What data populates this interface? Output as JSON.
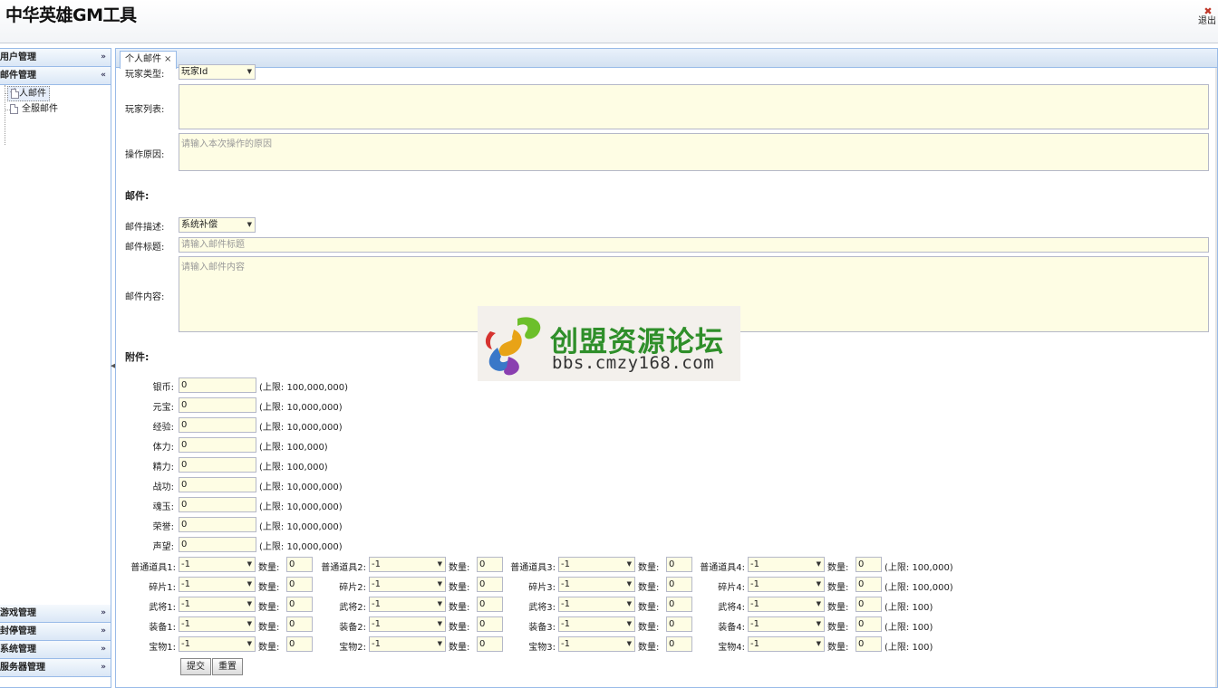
{
  "app": {
    "title": "中华英雄GM工具",
    "logout_label": "退出"
  },
  "sidebar": {
    "sections": [
      {
        "label": "用户管理",
        "expanded": false
      },
      {
        "label": "邮件管理",
        "expanded": true
      },
      {
        "label": "游戏管理",
        "expanded": false
      },
      {
        "label": "封停管理",
        "expanded": false
      },
      {
        "label": "系统管理",
        "expanded": false
      },
      {
        "label": "服务器管理",
        "expanded": false
      }
    ],
    "mail_items": [
      {
        "label": "个人邮件",
        "selected": true
      },
      {
        "label": "全服邮件",
        "selected": false
      }
    ]
  },
  "tab": {
    "label": "个人邮件",
    "close": "×"
  },
  "form": {
    "player_type_label": "玩家类型:",
    "player_type_value": "玩家Id",
    "player_list_label": "玩家列表:",
    "reason_label": "操作原因:",
    "reason_placeholder": "请输入本次操作的原因",
    "mail_section": "邮件:",
    "mail_desc_label": "邮件描述:",
    "mail_desc_value": "系统补偿",
    "mail_title_label": "邮件标题:",
    "mail_title_placeholder": "请输入邮件标题",
    "mail_content_label": "邮件内容:",
    "mail_content_placeholder": "请输入邮件内容",
    "attach_section": "附件:",
    "resources": [
      {
        "label": "银币:",
        "value": "0",
        "limit": "(上限: 100,000,000)"
      },
      {
        "label": "元宝:",
        "value": "0",
        "limit": "(上限: 10,000,000)"
      },
      {
        "label": "经验:",
        "value": "0",
        "limit": "(上限: 10,000,000)"
      },
      {
        "label": "体力:",
        "value": "0",
        "limit": "(上限: 100,000)"
      },
      {
        "label": "精力:",
        "value": "0",
        "limit": "(上限: 100,000)"
      },
      {
        "label": "战功:",
        "value": "0",
        "limit": "(上限: 10,000,000)"
      },
      {
        "label": "魂玉:",
        "value": "0",
        "limit": "(上限: 10,000,000)"
      },
      {
        "label": "荣誉:",
        "value": "0",
        "limit": "(上限: 10,000,000)"
      },
      {
        "label": "声望:",
        "value": "0",
        "limit": "(上限: 10,000,000)"
      }
    ],
    "qty_label": "数量:",
    "item_rows": [
      {
        "labels": [
          "普通道具1:",
          "普通道具2:",
          "普通道具3:",
          "普通道具4:"
        ],
        "select": "-1",
        "qty": "0",
        "limit": "(上限: 100,000)"
      },
      {
        "labels": [
          "碎片1:",
          "碎片2:",
          "碎片3:",
          "碎片4:"
        ],
        "select": "-1",
        "qty": "0",
        "limit": "(上限: 100,000)"
      },
      {
        "labels": [
          "武将1:",
          "武将2:",
          "武将3:",
          "武将4:"
        ],
        "select": "-1",
        "qty": "0",
        "limit": "(上限: 100)"
      },
      {
        "labels": [
          "装备1:",
          "装备2:",
          "装备3:",
          "装备4:"
        ],
        "select": "-1",
        "qty": "0",
        "limit": "(上限: 100)"
      },
      {
        "labels": [
          "宝物1:",
          "宝物2:",
          "宝物3:",
          "宝物4:"
        ],
        "select": "-1",
        "qty": "0",
        "limit": "(上限: 100)"
      }
    ],
    "submit_label": "提交",
    "reset_label": "重置"
  },
  "watermark": {
    "title": "创盟资源论坛",
    "url": "bbs.cmzy168.com"
  },
  "colors": {
    "input_bg": "#fefde4",
    "border": "#99bbe8",
    "watermark_green": "#2f8f2a"
  }
}
